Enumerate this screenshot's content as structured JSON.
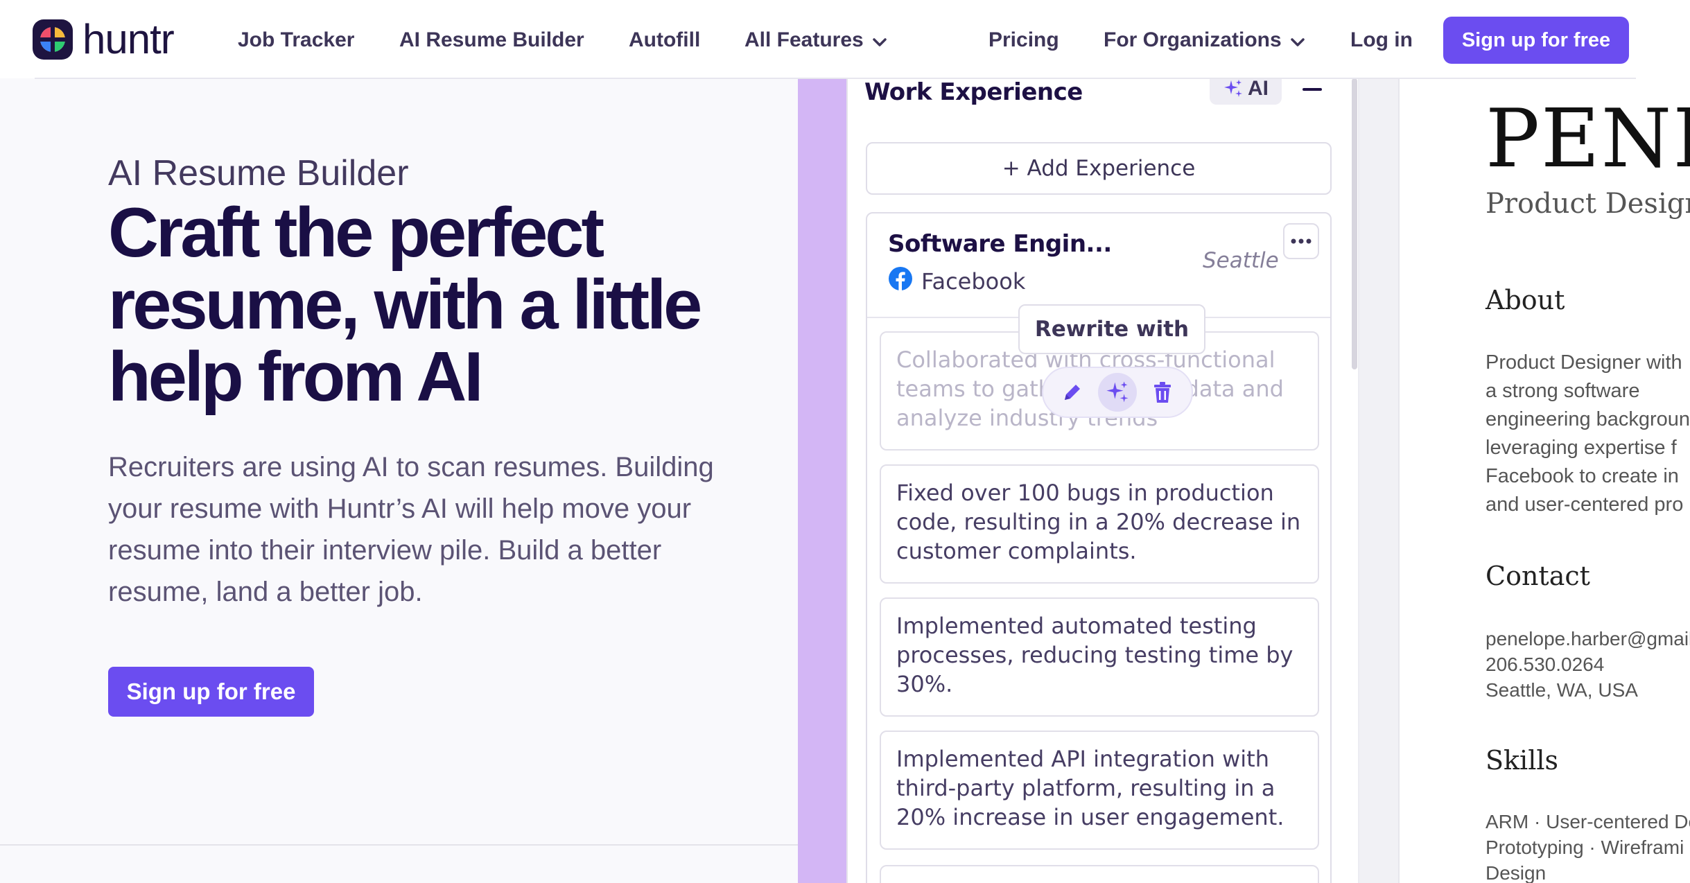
{
  "nav": {
    "logo_text": "huntr",
    "links": [
      "Job Tracker",
      "AI Resume Builder",
      "Autofill",
      "All Features",
      "Pricing",
      "For Organizations",
      "Log in"
    ],
    "signup": "Sign up for free"
  },
  "hero": {
    "eyebrow": "AI Resume Builder",
    "title": "Craft the perfect resume, with a little help from AI",
    "body": "Recruiters are using AI to scan resumes. Building your resume with Huntr’s AI will help move your resume into their interview pile. Build a better resume, land a better job.",
    "cta": "Sign up for free"
  },
  "editor": {
    "section_title": "Work Experience",
    "ai_chip": "AI",
    "add_experience": "+ Add Experience",
    "job_title": "Software Engin...",
    "company": "Facebook",
    "location": "Seattle",
    "tooltip": "Rewrite with AI",
    "bullets": [
      "Collaborated with cross-functional teams to gather research data and analyze industry trends",
      "Fixed over 100 bugs in production code, resulting in a 20% decrease in customer complaints.",
      "Implemented automated testing processes, reducing testing time by 30%.",
      "Implemented API integration with third-party platform, resulting in a 20% increase in user engagement."
    ],
    "icons": [
      "sparkle-icon",
      "minus-icon",
      "facebook-icon",
      "more-icon",
      "pencil-icon",
      "trash-icon"
    ]
  },
  "preview": {
    "name": "PENELOPE",
    "role": "Product Designer",
    "about_heading": "About",
    "about_lines": [
      "Product Designer with",
      "a strong software",
      "engineering background",
      "leveraging expertise f",
      "Facebook to create in",
      "and user-centered pro"
    ],
    "contact_heading": "Contact",
    "contact_lines": [
      "penelope.harber@gmail",
      "206.530.0264",
      "Seattle, WA, USA"
    ],
    "skills_heading": "Skills",
    "skills_lines": [
      "ARM · User-centered De",
      "Prototyping · Wireframi",
      "Design"
    ]
  },
  "colors": {
    "brand": "#6b4df0",
    "ink": "#1a0f45",
    "accent_strip": "#d3b6f5"
  }
}
